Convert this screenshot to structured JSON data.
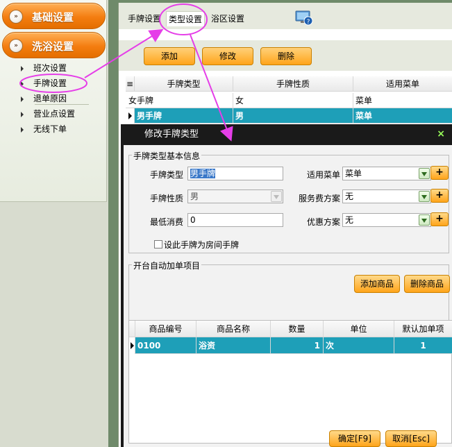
{
  "sidebar": {
    "groups": [
      {
        "label": "基础设置",
        "icon": "expand-icon"
      },
      {
        "label": "洗浴设置",
        "icon": "expand-icon"
      }
    ],
    "items": [
      {
        "label": "班次设置"
      },
      {
        "label": "手牌设置"
      },
      {
        "label": "退单原因"
      },
      {
        "label": "营业点设置"
      },
      {
        "label": "无线下单"
      }
    ]
  },
  "tabs": [
    {
      "label": "手牌设置"
    },
    {
      "label": "类型设置"
    },
    {
      "label": "浴区设置"
    }
  ],
  "toolbar": {
    "add": "添加",
    "edit": "修改",
    "delete": "删除"
  },
  "type_grid": {
    "columns": [
      "手牌类型",
      "手牌性质",
      "适用菜单"
    ],
    "rows": [
      [
        "女手牌",
        "女",
        "菜单"
      ],
      [
        "男手牌",
        "男",
        "菜单"
      ]
    ]
  },
  "dialog": {
    "title": "修改手牌类型",
    "close": "×",
    "basic_section": "手牌类型基本信息",
    "fields": {
      "type_label": "手牌类型",
      "type_value": "男手牌",
      "nature_label": "手牌性质",
      "nature_value": "男",
      "min_label": "最低消费",
      "min_value": "0",
      "menu_label": "适用菜单",
      "menu_value": "菜单",
      "service_label": "服务费方案",
      "service_value": "无",
      "discount_label": "优惠方案",
      "discount_value": "无",
      "plus": "+",
      "room_checkbox": "设此手牌为房间手牌"
    },
    "auto_section": "开台自动加单项目",
    "add_goods": "添加商品",
    "delete_goods": "删除商品",
    "goods_grid": {
      "columns": [
        "商品编号",
        "商品名称",
        "数量",
        "单位",
        "默认加单项"
      ],
      "rows": [
        [
          "0100",
          "浴资",
          "1",
          "次",
          "1"
        ]
      ]
    },
    "ok": "确定[F9]",
    "cancel": "取消[Esc]"
  },
  "colors": {
    "accent_orange": "#f47d10",
    "selection": "#1e9fb8",
    "annotation": "#e53ee8"
  }
}
